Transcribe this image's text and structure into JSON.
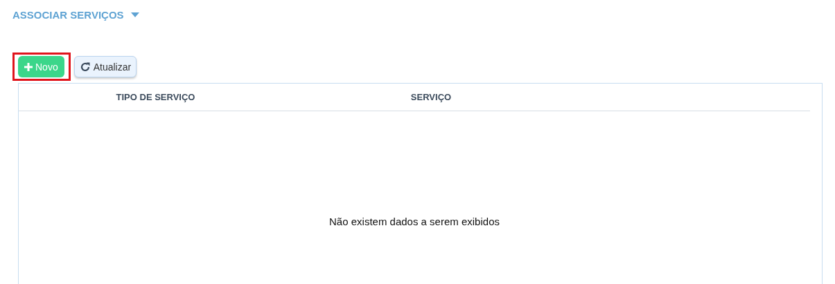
{
  "section": {
    "title": "ASSOCIAR SERVIÇOS",
    "expanded": true
  },
  "toolbar": {
    "buttons": [
      {
        "kind": "new",
        "label": "Novo",
        "highlighted": true
      },
      {
        "kind": "refresh",
        "label": "Atualizar",
        "highlighted": false
      }
    ]
  },
  "table": {
    "columns": [
      "TIPO DE SERVIÇO",
      "SERVIÇO"
    ],
    "empty_message": "Não existem dados a serem exibidos"
  }
}
